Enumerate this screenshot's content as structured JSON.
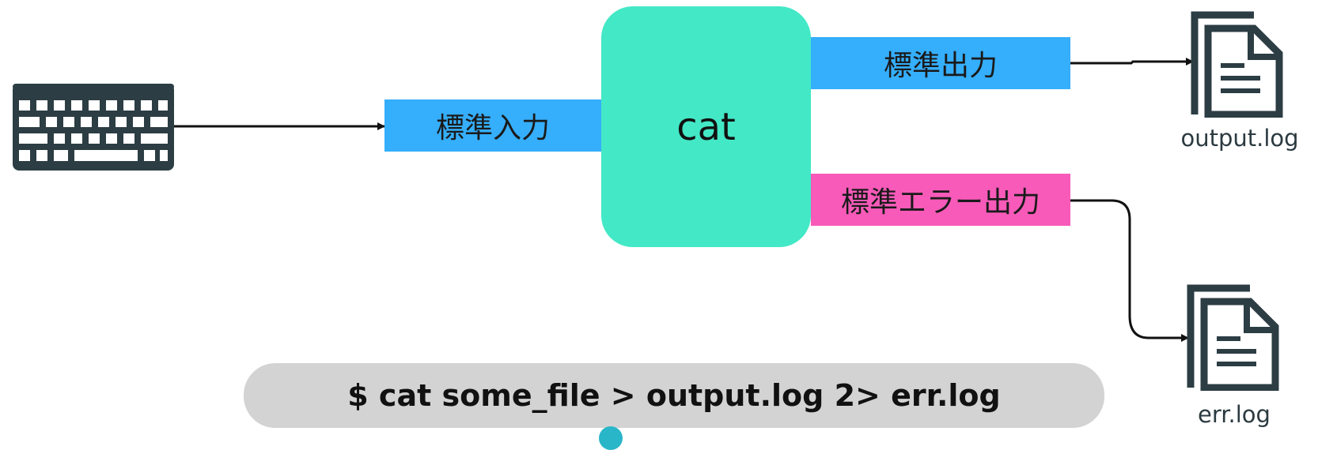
{
  "colors": {
    "stdin_fill": "#35aefc",
    "stdout_fill": "#35aefc",
    "stderr_fill": "#f75ab9",
    "process_fill": "#43e8c6",
    "command_fill": "#d3d3d3",
    "icon_color": "#2c3d44",
    "arrow_color": "#111111",
    "dot_color": "#29b6c8"
  },
  "input_device": {
    "icon": "keyboard-icon"
  },
  "stdin": {
    "label": "標準入力"
  },
  "process": {
    "label": "cat"
  },
  "stdout": {
    "label": "標準出力"
  },
  "stderr": {
    "label": "標準エラー出力"
  },
  "files": {
    "output": {
      "name": "output.log",
      "icon": "document-icon"
    },
    "error": {
      "name": "err.log",
      "icon": "document-icon"
    }
  },
  "command": {
    "text": "$ cat some_file > output.log 2> err.log"
  }
}
